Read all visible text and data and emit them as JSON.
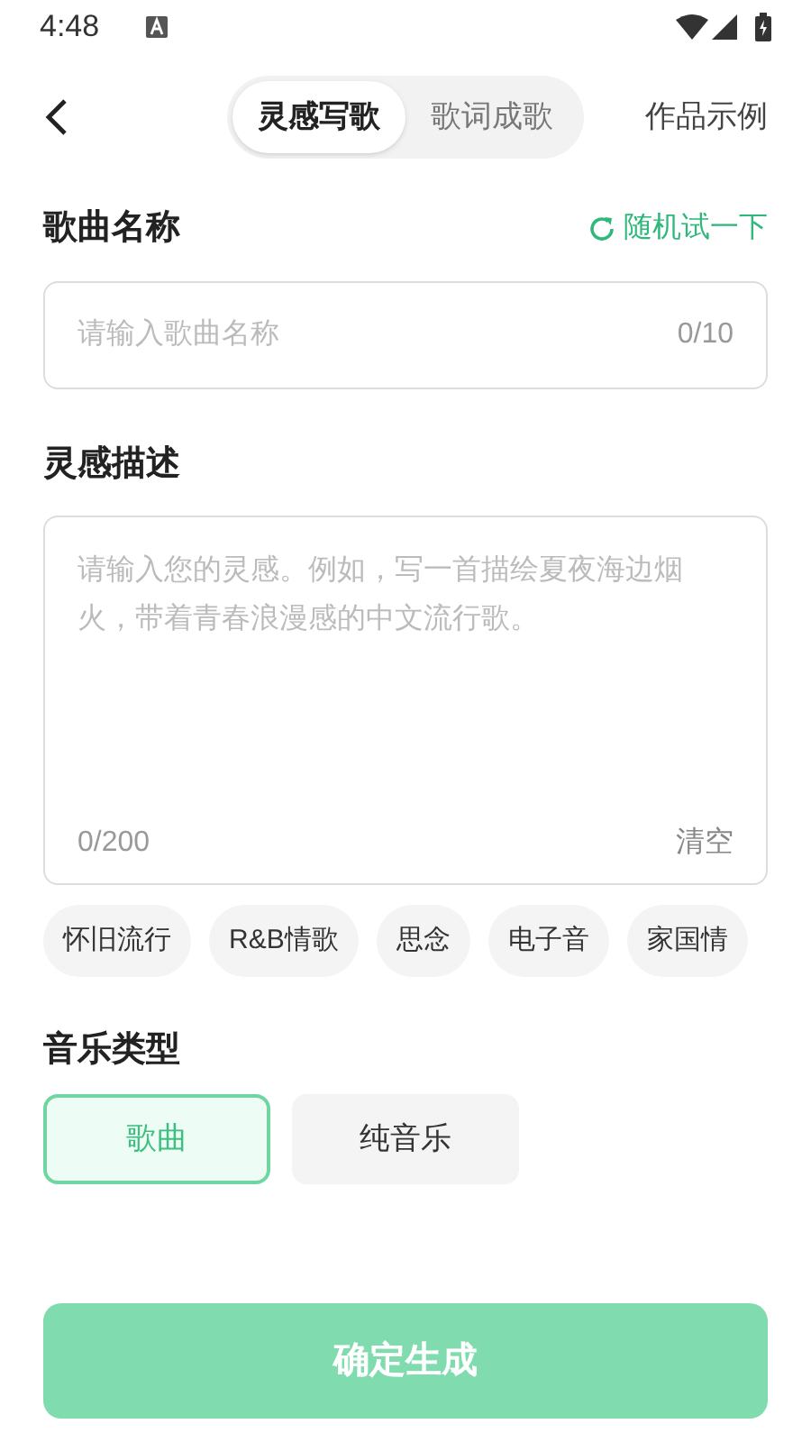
{
  "status_bar": {
    "time": "4:48"
  },
  "header": {
    "tabs": [
      {
        "label": "灵感写歌",
        "selected": true
      },
      {
        "label": "歌词成歌",
        "selected": false
      }
    ],
    "examples_link": "作品示例"
  },
  "song_name": {
    "title": "歌曲名称",
    "random_button": "随机试一下",
    "placeholder": "请输入歌曲名称",
    "count": "0/10"
  },
  "inspiration": {
    "title": "灵感描述",
    "placeholder": "请输入您的灵感。例如，写一首描绘夏夜海边烟火，带着青春浪漫感的中文流行歌。",
    "count": "0/200",
    "clear_button": "清空"
  },
  "tags": [
    "怀旧流行",
    "R&B情歌",
    "思念",
    "电子音",
    "家国情"
  ],
  "music_type": {
    "title": "音乐类型",
    "options": [
      {
        "label": "歌曲",
        "selected": true
      },
      {
        "label": "纯音乐",
        "selected": false
      }
    ]
  },
  "submit_button": "确定生成"
}
